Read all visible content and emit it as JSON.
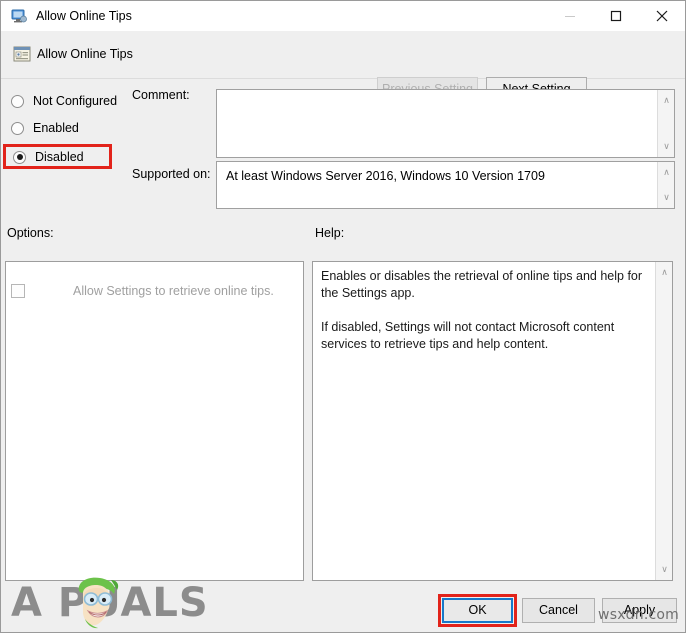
{
  "window": {
    "title": "Allow Online Tips",
    "title_icon": "monitor-icon",
    "controls": {
      "minimize": "minimize-icon",
      "maximize": "maximize-icon",
      "close": "close-icon"
    }
  },
  "header": {
    "policy_icon": "policy-setting-icon",
    "policy_title": "Allow Online Tips",
    "previous_setting_label": "Previous Setting",
    "next_setting_label": "Next Setting",
    "previous_setting_enabled": false,
    "next_setting_enabled": true
  },
  "state": {
    "options": [
      {
        "label": "Not Configured",
        "selected": false
      },
      {
        "label": "Enabled",
        "selected": false
      },
      {
        "label": "Disabled",
        "selected": true
      }
    ],
    "selected_value": "Disabled",
    "highlight_color": "#e2231a"
  },
  "fields": {
    "comment_label": "Comment:",
    "comment_value": "",
    "supported_on_label": "Supported on:",
    "supported_on_value": "At least Windows Server 2016, Windows 10 Version 1709",
    "scroll_up_glyph": "∧",
    "scroll_down_glyph": "∨"
  },
  "options_pane": {
    "label": "Options:",
    "checkbox_label": "Allow Settings to retrieve online tips.",
    "checkbox_checked": false,
    "checkbox_enabled": false
  },
  "help_pane": {
    "label": "Help:",
    "text": "Enables or disables the retrieval of online tips and help for the Settings app.\n\nIf disabled, Settings will not contact Microsoft content services to retrieve tips and help content."
  },
  "footer": {
    "ok_label": "OK",
    "cancel_label": "Cancel",
    "apply_label": "Apply",
    "ok_focused": true,
    "ok_highlight_color": "#e2231a",
    "ok_focus_color": "#1878c8"
  },
  "watermarks": {
    "brand_text": "A   PUALS",
    "site_text": "wsxdn.com"
  }
}
